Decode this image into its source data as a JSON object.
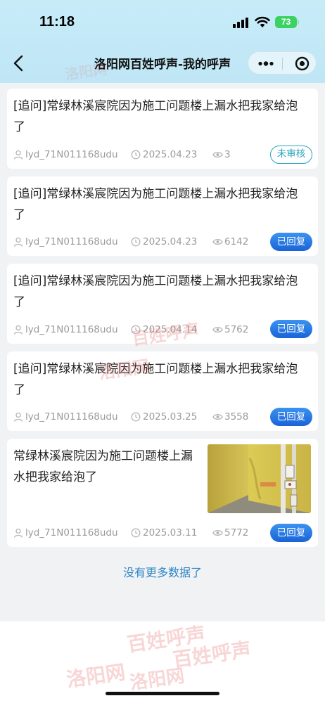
{
  "status_bar": {
    "time": "11:18",
    "battery": "73"
  },
  "nav": {
    "title": "洛阳网百姓呼声-我的呼声"
  },
  "posts": [
    {
      "title": "[追问]常绿林溪宸院因为施工问题楼上漏水把我家给泡了",
      "user": "lyd_71N011168udu",
      "date": "2025.04.23",
      "views": "3",
      "status": "未审核"
    },
    {
      "title": "[追问]常绿林溪宸院因为施工问题楼上漏水把我家给泡了",
      "user": "lyd_71N011168udu",
      "date": "2025.04.23",
      "views": "6142",
      "status": "已回复"
    },
    {
      "title": "[追问]常绿林溪宸院因为施工问题楼上漏水把我家给泡了",
      "user": "lyd_71N011168udu",
      "date": "2025.04.14",
      "views": "5762",
      "status": "已回复"
    },
    {
      "title": "[追问]常绿林溪宸院因为施工问题楼上漏水把我家给泡了",
      "user": "lyd_71N011168udu",
      "date": "2025.03.25",
      "views": "3558",
      "status": "已回复"
    },
    {
      "title": "常绿林溪宸院因为施工问题楼上漏水把我家给泡了",
      "user": "lyd_71N011168udu",
      "date": "2025.03.11",
      "views": "5772",
      "status": "已回复"
    }
  ],
  "list_end_text": "没有更多数据了",
  "watermark": {
    "text_a": "洛阳网",
    "text_b": "百姓呼声"
  },
  "colors": {
    "nav_bg": "#c7ecf8",
    "pending": "#28a4b8",
    "replied": "#1a63d8",
    "link": "#2c86c6"
  },
  "icons": {
    "back": "chevron-left-icon",
    "more": "more-dots-icon",
    "close_miniprogram": "target-circle-icon",
    "user": "user-icon",
    "time": "clock-icon",
    "views": "eye-icon"
  }
}
